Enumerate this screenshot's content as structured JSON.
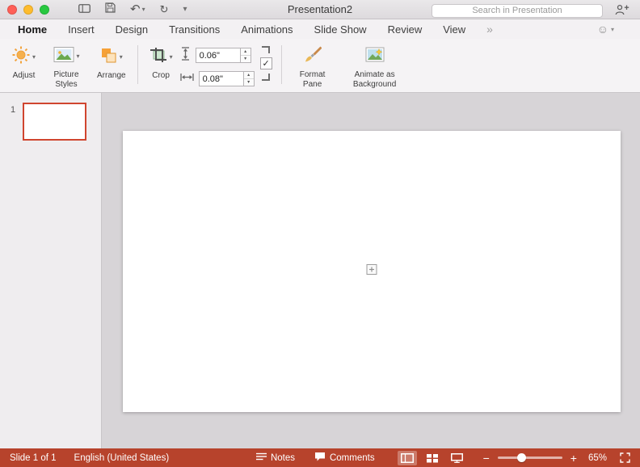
{
  "titlebar": {
    "title": "Presentation2",
    "search": {
      "placeholder": "Search in Presentation"
    }
  },
  "tabs": [
    {
      "label": "Home"
    },
    {
      "label": "Insert"
    },
    {
      "label": "Design"
    },
    {
      "label": "Transitions"
    },
    {
      "label": "Animations"
    },
    {
      "label": "Slide Show"
    },
    {
      "label": "Review"
    },
    {
      "label": "View"
    },
    {
      "label": "»"
    }
  ],
  "ribbon": {
    "adjust": {
      "label": "Adjust"
    },
    "picture_styles": {
      "label": "Picture Styles"
    },
    "arrange": {
      "label": "Arrange"
    },
    "crop": {
      "label": "Crop"
    },
    "crop_height": {
      "value": "0.06\""
    },
    "crop_width": {
      "value": "0.08\""
    },
    "format_pane": {
      "label": "Format Pane"
    },
    "animate_background": {
      "label": "Animate as Background"
    }
  },
  "slide_panel": {
    "slide_number": "1"
  },
  "statusbar": {
    "slide_indicator": "Slide 1 of 1",
    "language": "English (United States)",
    "notes": "Notes",
    "comments": "Comments",
    "zoom_level": "65%"
  },
  "icons": {
    "undo": "↶",
    "redo": "↻",
    "caret_down": "▾",
    "toolbar_chevron": "▾",
    "smiley": "☺",
    "check": "✓",
    "minus": "−",
    "plus": "+",
    "step_up": "▴",
    "step_down": "▾"
  },
  "colors": {
    "status_bar_red": "#b7432c",
    "selected_slide_border": "#d0452f"
  }
}
